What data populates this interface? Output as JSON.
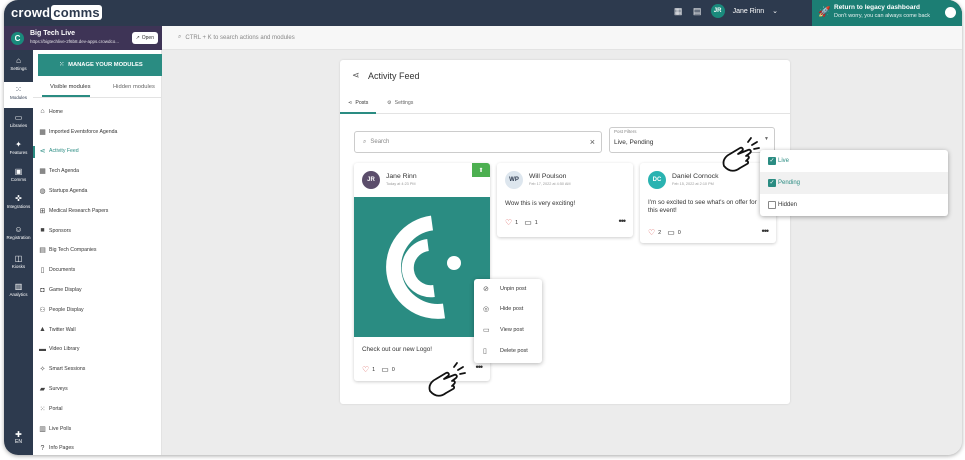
{
  "topbar": {
    "logo_part1": "crowd",
    "logo_part2": "comms",
    "user_initials": "JR",
    "user_name": "Jane Rinn",
    "legacy_title": "Return to legacy dashboard",
    "legacy_subtitle": "Don't worry, you can always come back"
  },
  "event": {
    "logo_letter": "C",
    "name": "Big Tech Live",
    "url": "https://bigtechlive-2f6b8.dev-apps.crowdco...",
    "open_label": "Open"
  },
  "command_bar": {
    "placeholder": "CTRL + K to search actions and modules"
  },
  "rail": {
    "items": [
      {
        "label": "Settings",
        "icon": "home-icon"
      },
      {
        "label": "Modules",
        "icon": "grid-icon"
      },
      {
        "label": "Libraries",
        "icon": "folder-icon"
      },
      {
        "label": "Features",
        "icon": "sparkle-icon"
      },
      {
        "label": "Comms",
        "icon": "comms-icon"
      },
      {
        "label": "Integrations",
        "icon": "puzzle-icon"
      },
      {
        "label": "Registration",
        "icon": "user-icon"
      },
      {
        "label": "Kiosks",
        "icon": "kiosk-icon"
      },
      {
        "label": "Analytics",
        "icon": "chart-icon"
      }
    ],
    "language": "EN"
  },
  "sidebar": {
    "manage_label": "MANAGE YOUR MODULES",
    "tab_visible": "Visible modules",
    "tab_hidden": "Hidden modules",
    "modules": [
      {
        "label": "Home",
        "icon": "home-icon"
      },
      {
        "label": "Imported Eventsforce Agenda",
        "icon": "calendar-icon"
      },
      {
        "label": "Activity Feed",
        "icon": "share-icon"
      },
      {
        "label": "Tech Agenda",
        "icon": "calendar-icon"
      },
      {
        "label": "Startups Agenda",
        "icon": "globe-icon"
      },
      {
        "label": "Medical Research Papers",
        "icon": "medical-icon"
      },
      {
        "label": "Sponsors",
        "icon": "briefcase-icon"
      },
      {
        "label": "Big Tech Companies",
        "icon": "building-icon"
      },
      {
        "label": "Documents",
        "icon": "document-icon"
      },
      {
        "label": "Game Display",
        "icon": "gamepad-icon"
      },
      {
        "label": "People Display",
        "icon": "people-icon"
      },
      {
        "label": "Twitter Wall",
        "icon": "thumbs-up-icon"
      },
      {
        "label": "Video Library",
        "icon": "video-icon"
      },
      {
        "label": "Smart Sessions",
        "icon": "sparkle-icon"
      },
      {
        "label": "Surveys",
        "icon": "chat-icon"
      },
      {
        "label": "Portal",
        "icon": "grid-icon"
      },
      {
        "label": "Live Polls",
        "icon": "poll-icon"
      },
      {
        "label": "Info Pages",
        "icon": "help-icon"
      }
    ]
  },
  "panel": {
    "title": "Activity Feed",
    "tab_posts": "Posts",
    "tab_settings": "Settings",
    "search_placeholder": "Search",
    "filter_label": "Post Filters",
    "filter_value": "Live, Pending"
  },
  "posts": [
    {
      "initials": "JR",
      "name": "Jane Rinn",
      "time": "Today at 4:23 PM",
      "text": "Check out our new Logo!",
      "likes": "1",
      "comments": "0"
    },
    {
      "initials": "WP",
      "name": "Will Poulson",
      "time": "Feb 17, 2022 at 4:50 AM",
      "text": "Wow this is very exciting!",
      "likes": "1",
      "comments": "1"
    },
    {
      "initials": "DC",
      "name": "Daniel Cornock",
      "time": "Feb 15, 2022 at 2:10 PM",
      "text": "I'm so excited to see what's on offer for this event!",
      "likes": "2",
      "comments": "0"
    }
  ],
  "context_menu": {
    "unpin": "Unpin post",
    "hide": "Hide post",
    "view": "View post",
    "delete": "Delete post"
  },
  "filter_options": [
    {
      "label": "Live",
      "checked": true
    },
    {
      "label": "Pending",
      "checked": true
    },
    {
      "label": "Hidden",
      "checked": false
    }
  ],
  "colors": {
    "accent": "#2a8c82",
    "navy": "#2d3a4e",
    "event_bar": "#3e3456",
    "like": "#d9534f"
  }
}
